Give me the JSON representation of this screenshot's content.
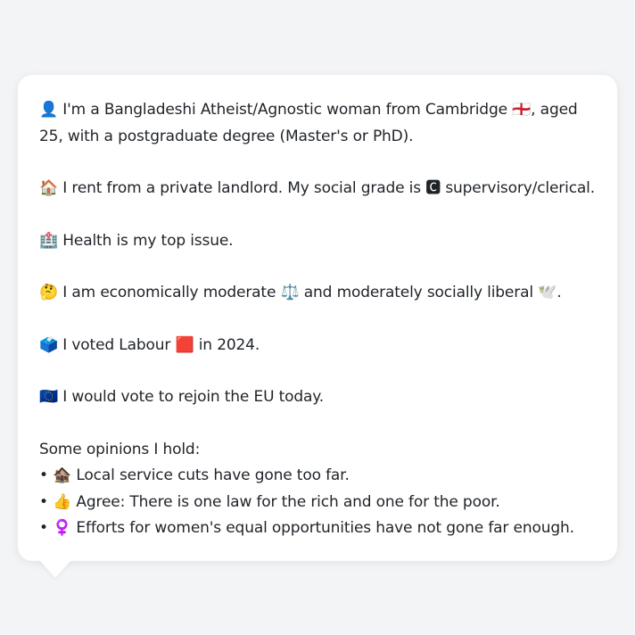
{
  "profile": {
    "intro": "👤 I'm a Bangladeshi Atheist/Agnostic woman from Cambridge 🏴󠁧󠁢󠁥󠁮󠁧󠁿, aged 25, with a postgraduate degree (Master's or PhD).",
    "housing": "🏠 I rent from a private landlord. My social grade is 🅲 supervisory/clerical.",
    "top_issue": "🏥 Health is my top issue.",
    "ideology": "🤔 I am economically moderate ⚖️ and moderately socially liberal 🕊️.",
    "vote_2024": "🗳️ I voted Labour 🟥 in 2024.",
    "eu": "🇪🇺 I would vote to rejoin the EU today."
  },
  "opinions": {
    "heading": "Some opinions I hold:",
    "items": [
      "• 🏚️ Local service cuts have gone too far.",
      "• 👍 Agree: There is one law for the rich and one for the poor.",
      "• ♀️ Efforts for women's equal opportunities have not gone far enough."
    ]
  }
}
